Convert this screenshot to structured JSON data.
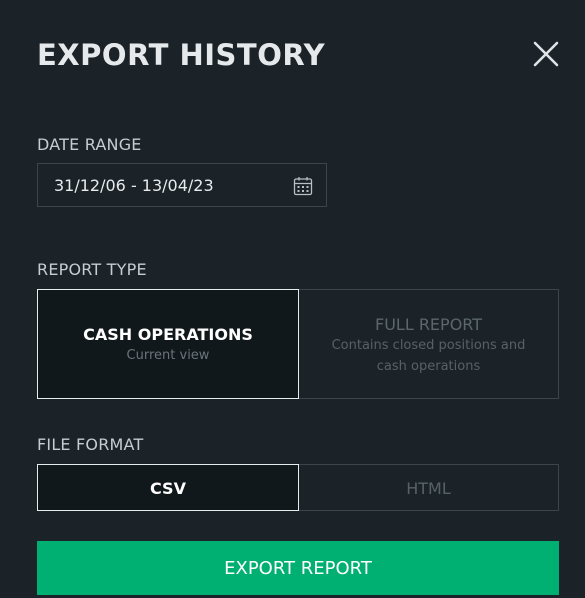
{
  "dialog": {
    "title": "EXPORT HISTORY",
    "close_icon": "close-icon"
  },
  "date_range": {
    "label": "DATE RANGE",
    "value": "31/12/06 - 13/04/23",
    "icon": "calendar-icon"
  },
  "report_type": {
    "label": "REPORT TYPE",
    "options": [
      {
        "title": "CASH OPERATIONS",
        "subtitle": "Current view",
        "selected": true
      },
      {
        "title": "FULL REPORT",
        "subtitle": "Contains closed positions and cash operations",
        "selected": false
      }
    ]
  },
  "file_format": {
    "label": "FILE FORMAT",
    "options": [
      {
        "label": "CSV",
        "selected": true
      },
      {
        "label": "HTML",
        "selected": false
      }
    ]
  },
  "export_button": {
    "label": "EXPORT REPORT"
  },
  "colors": {
    "background": "#1b2328",
    "accent": "#00b073",
    "border": "#3a454c",
    "selected_border": "#e8ebed"
  }
}
